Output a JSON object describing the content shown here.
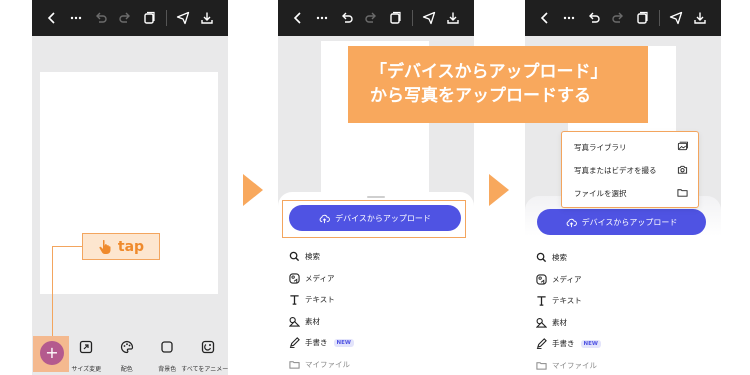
{
  "steps": {
    "step1": {
      "tap_label": "tap",
      "add_symbol": "+",
      "tools": [
        {
          "label": "サイズ変更",
          "icon": "resize-icon"
        },
        {
          "label": "配色",
          "icon": "palette-icon"
        },
        {
          "label": "背景色",
          "icon": "background-color-icon"
        },
        {
          "label": "すべてをアニメート",
          "icon": "animate-all-icon"
        }
      ]
    },
    "step2": {
      "upload_label": "デバイスからアップロード",
      "menu": [
        {
          "label": "検索",
          "icon": "search-icon"
        },
        {
          "label": "メディア",
          "icon": "media-icon"
        },
        {
          "label": "テキスト",
          "icon": "text-icon"
        },
        {
          "label": "素材",
          "icon": "elements-icon"
        },
        {
          "label": "手書き",
          "icon": "draw-icon",
          "badge": "NEW"
        },
        {
          "label": "マイファイル",
          "icon": "folder-icon"
        }
      ]
    },
    "step3": {
      "upload_label": "デバイスからアップロード",
      "popup": [
        {
          "label": "写真ライブラリ",
          "icon": "photo-library-icon"
        },
        {
          "label": "写真またはビデオを撮る",
          "icon": "camera-icon"
        },
        {
          "label": "ファイルを選択",
          "icon": "folder-icon"
        }
      ],
      "menu": [
        {
          "label": "検索",
          "icon": "search-icon"
        },
        {
          "label": "メディア",
          "icon": "media-icon"
        },
        {
          "label": "テキスト",
          "icon": "text-icon"
        },
        {
          "label": "素材",
          "icon": "elements-icon"
        },
        {
          "label": "手書き",
          "icon": "draw-icon",
          "badge": "NEW"
        },
        {
          "label": "マイファイル",
          "icon": "folder-icon"
        }
      ]
    }
  },
  "banner": {
    "line1": "「デバイスからアップロード」",
    "line2": "から写真をアップロードする"
  },
  "colors": {
    "accent_orange": "#f8a85d",
    "upload_button": "#4f53e3",
    "add_button": "#b45a8e",
    "topbar": "#1f1f1f"
  }
}
